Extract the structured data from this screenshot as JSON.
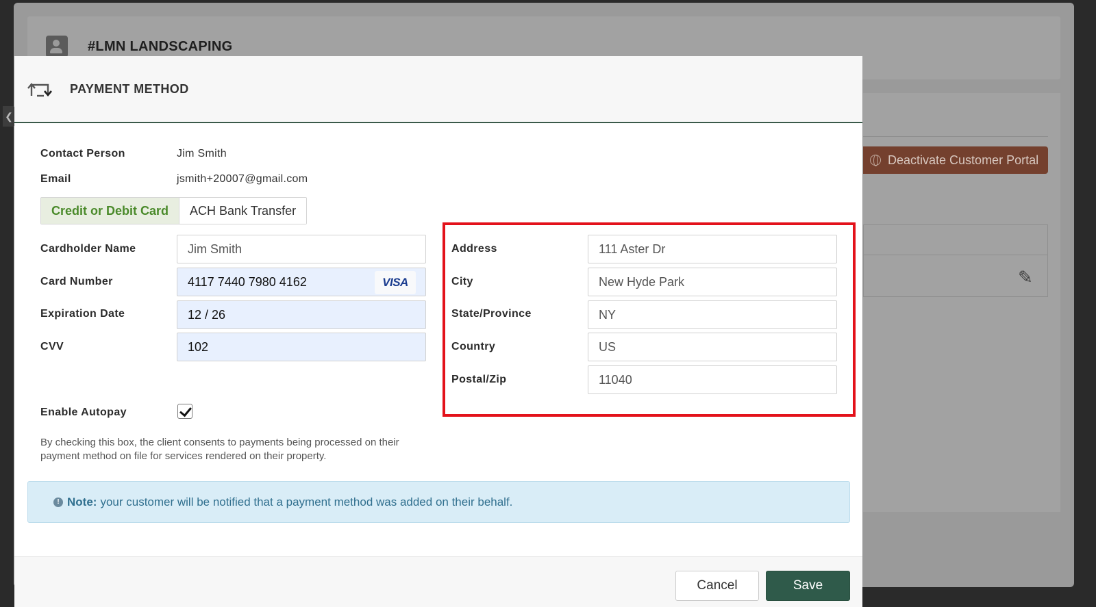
{
  "background": {
    "page_title": "#LMN LANDSCAPING",
    "deactivate_button": "Deactivate Customer Portal"
  },
  "modal": {
    "title": "PAYMENT METHOD",
    "contact_person_label": "Contact Person",
    "contact_person_value": "Jim Smith",
    "email_label": "Email",
    "email_value": "jsmith+20007@gmail.com",
    "tabs": [
      {
        "label": "Credit or Debit Card",
        "active": true
      },
      {
        "label": "ACH Bank Transfer",
        "active": false
      }
    ],
    "card": {
      "cardholder_label": "Cardholder Name",
      "cardholder_value": "Jim Smith",
      "number_label": "Card Number",
      "number_value": "4117 7440 7980 4162",
      "brand": "VISA",
      "expiration_label": "Expiration Date",
      "expiration_value": "12 / 26",
      "cvv_label": "CVV",
      "cvv_value": "102"
    },
    "address": {
      "address_label": "Address",
      "address_value": "111 Aster Dr",
      "city_label": "City",
      "city_value": "New Hyde Park",
      "state_label": "State/Province",
      "state_value": "NY",
      "country_label": "Country",
      "country_value": "US",
      "postal_label": "Postal/Zip",
      "postal_value": "11040"
    },
    "autopay_label": "Enable Autopay",
    "autopay_checked": true,
    "consent_text": "By checking this box, the client consents to payments being processed on their payment method on file for services rendered on their property.",
    "note_bold": "Note:",
    "note_text": "your customer will be notified that a payment method was added on their behalf.",
    "cancel_label": "Cancel",
    "save_label": "Save"
  },
  "colors": {
    "accent_green": "#4a8a2a",
    "save_button": "#2f5a4a",
    "highlight_red": "#e3121b",
    "autofill_blue": "#e8f0fe",
    "note_bg": "#d9edf7"
  }
}
